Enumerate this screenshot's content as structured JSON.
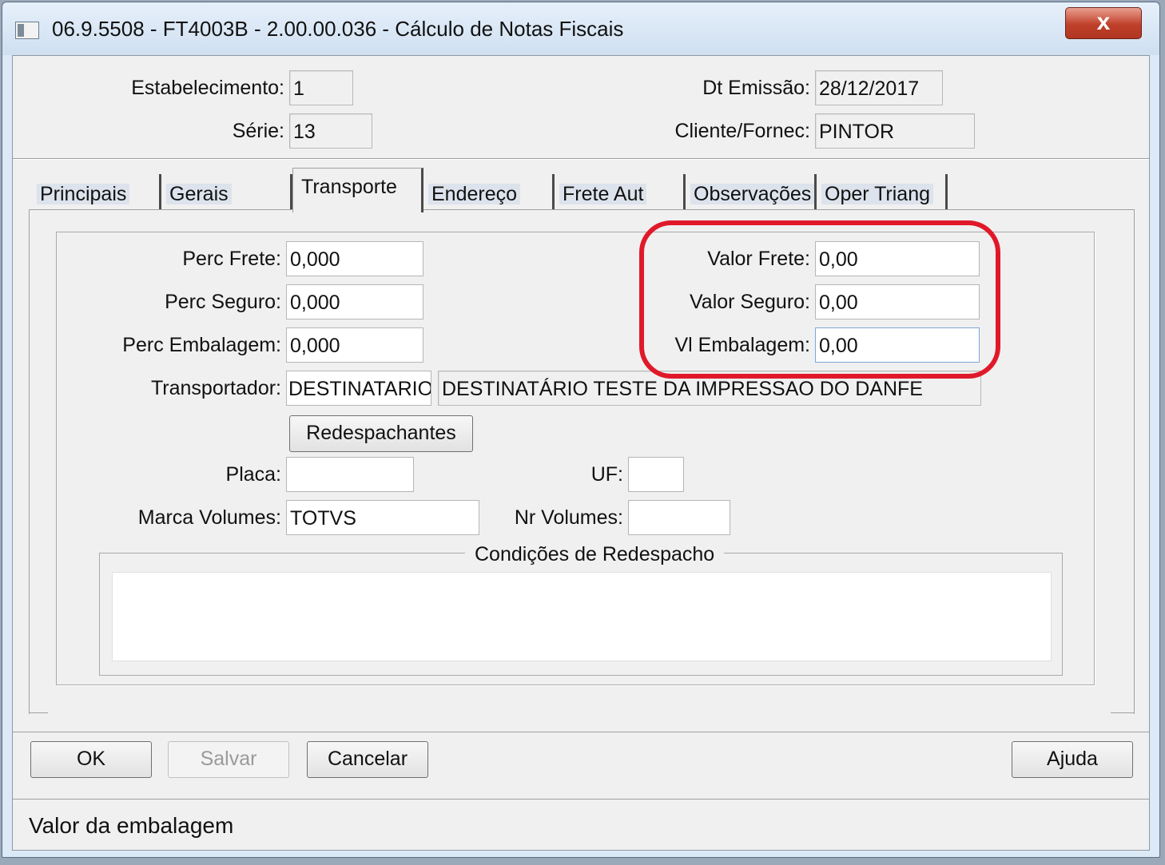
{
  "window": {
    "title": "06.9.5508 - FT4003B - 2.00.00.036 - Cálculo de Notas Fiscais",
    "close_label": "x"
  },
  "header": {
    "estabelecimento_label": "Estabelecimento:",
    "estabelecimento_value": "1",
    "serie_label": "Série:",
    "serie_value": "13",
    "dt_emissao_label": "Dt Emissão:",
    "dt_emissao_value": "28/12/2017",
    "cliente_label": "Cliente/Fornec:",
    "cliente_value": "PINTOR"
  },
  "tabs": [
    {
      "label": "Principais"
    },
    {
      "label": "Gerais"
    },
    {
      "label": "Transporte",
      "active": true
    },
    {
      "label": "Endereço"
    },
    {
      "label": "Frete Aut"
    },
    {
      "label": "Observações"
    },
    {
      "label": "Oper Triang"
    }
  ],
  "transporte": {
    "perc_frete_label": "Perc Frete:",
    "perc_frete_value": "0,000",
    "perc_seguro_label": "Perc Seguro:",
    "perc_seguro_value": "0,000",
    "perc_embalagem_label": "Perc Embalagem:",
    "perc_embalagem_value": "0,000",
    "valor_frete_label": "Valor Frete:",
    "valor_frete_value": "0,00",
    "valor_seguro_label": "Valor Seguro:",
    "valor_seguro_value": "0,00",
    "vl_embalagem_label": "Vl Embalagem:",
    "vl_embalagem_value": "0,00",
    "transportador_label": "Transportador:",
    "transportador_code": "DESTINATARIO",
    "transportador_name": "DESTINATÁRIO TESTE DA IMPRESSAO DO DANFE",
    "redespachantes_label": "Redespachantes",
    "placa_label": "Placa:",
    "placa_value": "",
    "uf_label": "UF:",
    "uf_value": "",
    "marca_volumes_label": "Marca Volumes:",
    "marca_volumes_value": "TOTVS",
    "nr_volumes_label": "Nr Volumes:",
    "nr_volumes_value": "",
    "condicoes_label": "Condições de Redespacho",
    "condicoes_value": ""
  },
  "buttons": {
    "ok": "OK",
    "salvar": "Salvar",
    "cancelar": "Cancelar",
    "ajuda": "Ajuda"
  },
  "status": {
    "text": "Valor da embalagem"
  },
  "colors": {
    "highlight": "#e0192a",
    "window_frame": "#dce9f7",
    "client_bg": "#f0f0f0"
  }
}
